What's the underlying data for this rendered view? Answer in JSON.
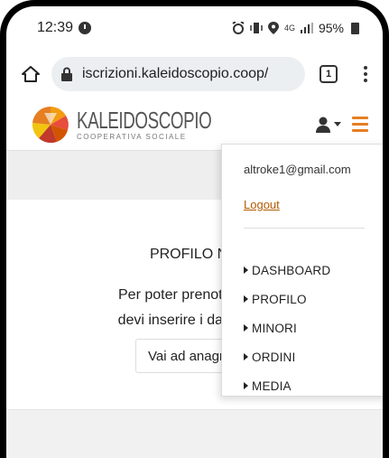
{
  "status_bar": {
    "time": "12:39",
    "icons": [
      "alarm-icon",
      "vibrate-icon",
      "location-icon",
      "signal-icon",
      "battery-icon"
    ],
    "network": "4G",
    "battery": "95%"
  },
  "browser": {
    "url": "iscrizioni.kaleidoscopio.coop/",
    "tab_count": "1"
  },
  "site": {
    "logo_name": "KALEIDOSCOPIO",
    "logo_sub": "COOPERATIVA SOCIALE",
    "accent_color": "#e67e22"
  },
  "main": {
    "title": "PROFILO NON I",
    "message_line1": "Per poter prenotare le a",
    "message_line2": "devi inserire i dati anagr",
    "button_label": "Vai ad anagr"
  },
  "dropdown": {
    "email": "altroke1@gmail.com",
    "logout_label": "Logout",
    "items": [
      {
        "label": "DASHBOARD"
      },
      {
        "label": "PROFILO"
      },
      {
        "label": "MINORI"
      },
      {
        "label": "ORDINI"
      },
      {
        "label": "MEDIA"
      }
    ]
  }
}
